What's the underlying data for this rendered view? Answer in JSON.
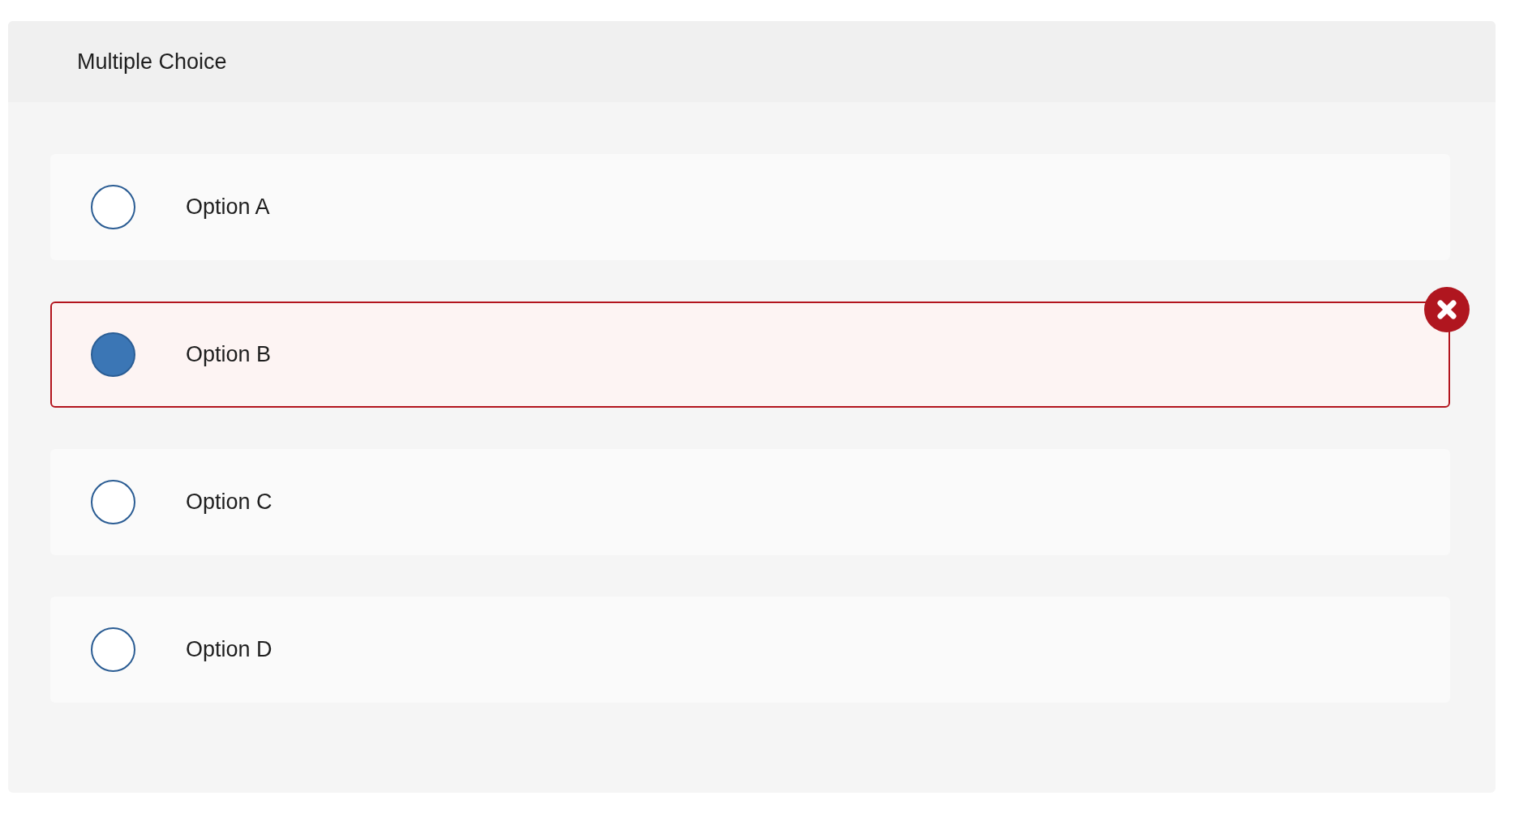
{
  "question": {
    "title": "Multiple Choice"
  },
  "options": [
    {
      "label": "Option A",
      "selected": false,
      "incorrect": false
    },
    {
      "label": "Option B",
      "selected": true,
      "incorrect": true
    },
    {
      "label": "Option C",
      "selected": false,
      "incorrect": false
    },
    {
      "label": "Option D",
      "selected": false,
      "incorrect": false
    }
  ]
}
